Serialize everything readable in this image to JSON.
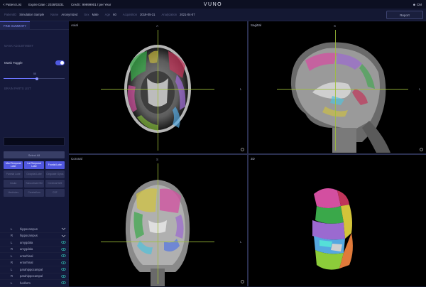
{
  "topbar": {
    "back_label": "< Patient List",
    "expire": "Expire Date : 2028/03/31",
    "credit": "Credit : 99999901 / per Year",
    "logo": "VUNO",
    "user": "CM"
  },
  "infobar": {
    "patient_id_label": "PatientID",
    "patient_id": "Simulation Sample",
    "name_label": "Name",
    "name": "Anonymized",
    "sex_label": "Sex",
    "sex": "Male",
    "age_label": "Age",
    "age": "60",
    "acq_label": "Acquisition",
    "acq_date": "2019-05-31",
    "analysis_label": "Analyzation",
    "analysis_date": "2021-04-07",
    "report_label": "Report"
  },
  "sidebar": {
    "tab_active": "FINE SUMMARY",
    "tab_inactive": "",
    "mask_section": "MASK ADJUSTMENT",
    "mask_toggle_label": "Mask Toggle",
    "opacity_value": "55",
    "opacity_fraction": 0.55,
    "brain_parts_section": "BRAIN PARTS LIST",
    "select_all_label": "Select All",
    "lobes": [
      {
        "label": "Med Temporal Lobe",
        "on": true
      },
      {
        "label": "Lat Temporal Lobe",
        "on": true
      },
      {
        "label": "Frontal Lobe",
        "on": true
      },
      {
        "label": "Parietal Lobe",
        "on": false
      },
      {
        "label": "Occipital Lobe",
        "on": false
      },
      {
        "label": "Cingulate Gyrus",
        "on": false
      },
      {
        "label": "Insula",
        "on": false
      },
      {
        "label": "Subcortical GM",
        "on": false
      },
      {
        "label": "Cerebral WM",
        "on": false
      },
      {
        "label": "Ventricles",
        "on": false
      },
      {
        "label": "Cerebellum",
        "on": false
      },
      {
        "label": "CSF",
        "on": false
      }
    ],
    "structures": [
      {
        "side": "L",
        "name": "hippocampus",
        "icon": "chevron-down-icon"
      },
      {
        "side": "R",
        "name": "hippocampus",
        "icon": "chevron-down-icon"
      },
      {
        "side": "L",
        "name": "amygdala",
        "icon": "eye-icon"
      },
      {
        "side": "R",
        "name": "amygdala",
        "icon": "eye-icon"
      },
      {
        "side": "L",
        "name": "entorhinal",
        "icon": "eye-icon"
      },
      {
        "side": "R",
        "name": "entorhinal",
        "icon": "eye-icon"
      },
      {
        "side": "L",
        "name": "parahippocampal",
        "icon": "eye-icon"
      },
      {
        "side": "R",
        "name": "parahippocampal",
        "icon": "eye-icon"
      },
      {
        "side": "L",
        "name": "fusiform",
        "icon": "eye-icon"
      }
    ]
  },
  "viewer": {
    "axial_label": "Axial",
    "sagittal_label": "Sagittal",
    "coronal_label": "Coronal",
    "threed_label": "3D",
    "orient_a": "A",
    "orient_l": "L",
    "orient_s": "S"
  },
  "colors": {
    "accent": "#5057e0",
    "crosshair": "#9fc03a",
    "panel_bg": "#000000",
    "sidebar_bg": "#15193a"
  }
}
